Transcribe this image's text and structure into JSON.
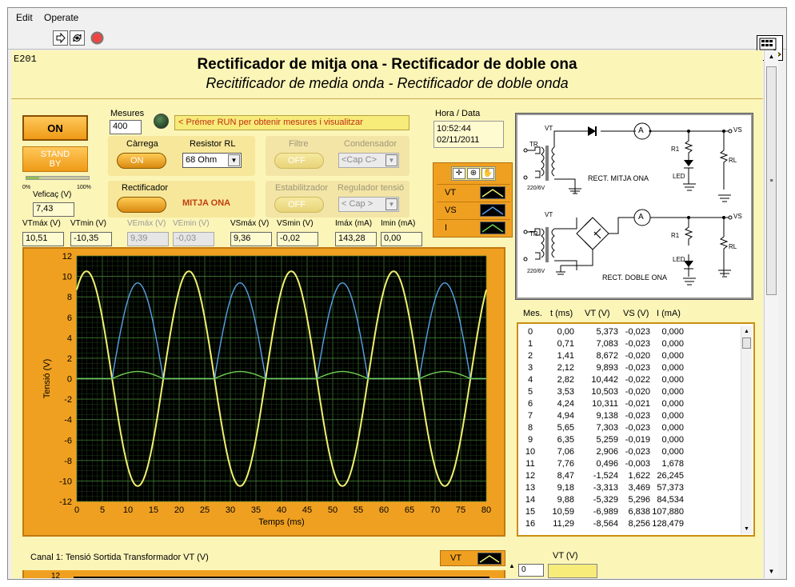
{
  "menu": {
    "edit": "Edit",
    "operate": "Operate"
  },
  "vi_icon": {
    "number": "1"
  },
  "panel": {
    "id": "E201",
    "title_cat": "Rectificador de mitja ona - Rectificador de doble ona",
    "title_es": "Recitificador de media onda - Rectificador de doble onda",
    "on_button": "ON",
    "standby_button": "STAND BY",
    "slider": {
      "min": "0%",
      "max": "100%",
      "value": 0.2
    },
    "mesures": {
      "label": "Mesures",
      "value": "400"
    },
    "message": "< Prémer RUN per obtenir mesures i visualitzar",
    "datetime": {
      "label": "Hora / Data",
      "time": "10:52:44",
      "date": "02/11/2011"
    },
    "carrega": {
      "label": "Càrrega",
      "state": "ON"
    },
    "resistor": {
      "label": "Resistor RL",
      "value": "68 Ohm"
    },
    "filtre": {
      "label": "Filtre",
      "state": "OFF"
    },
    "condensador": {
      "label": "Condensador",
      "value": "<Cap C>"
    },
    "rectificador": {
      "label": "Rectificador",
      "state_label": "MITJA ONA"
    },
    "estabilitzador": {
      "label": "Estabilitzador",
      "state": "OFF"
    },
    "regulador": {
      "label": "Regulador tensió",
      "value": "< Cap >"
    },
    "veficac": {
      "label": "Veficaç (V)",
      "value": "7,43"
    },
    "measurements": [
      {
        "label": "VTmáx (V)",
        "value": "10,51",
        "disabled": false
      },
      {
        "label": "VTmin (V)",
        "value": "-10,35",
        "disabled": false
      },
      {
        "label": "VEmáx (V)",
        "value": "9,39",
        "disabled": true
      },
      {
        "label": "VEmin (V)",
        "value": "-0,03",
        "disabled": true
      },
      {
        "label": "VSmáx (V)",
        "value": "9,36",
        "disabled": false
      },
      {
        "label": "VSmin (V)",
        "value": "-0,02",
        "disabled": false
      },
      {
        "label": "Imáx (mA)",
        "value": "143,28",
        "disabled": false
      },
      {
        "label": "Imin (mA)",
        "value": "0,00",
        "disabled": false
      }
    ],
    "legend": [
      {
        "name": "VT",
        "color": "#f0f070"
      },
      {
        "name": "VS",
        "color": "#5aa0e6"
      },
      {
        "name": "I",
        "color": "#70d050"
      }
    ],
    "circuit": {
      "label_half": "RECT. MITJA ONA",
      "label_full": "RECT. DOBLE ONA",
      "vt": "VT",
      "vs": "VS",
      "tr": "TR",
      "r1": "R1",
      "rl": "RL",
      "led": "LED",
      "a": "A",
      "mains": "220/6V"
    },
    "table": {
      "headers": [
        "Mes.",
        "t (ms)",
        "VT (V)",
        "VS (V)",
        "I (mA)"
      ],
      "rows": [
        [
          "0",
          "0,00",
          "5,373",
          "-0,023",
          "0,000"
        ],
        [
          "1",
          "0,71",
          "7,083",
          "-0,023",
          "0,000"
        ],
        [
          "2",
          "1,41",
          "8,672",
          "-0,020",
          "0,000"
        ],
        [
          "3",
          "2,12",
          "9,893",
          "-0,023",
          "0,000"
        ],
        [
          "4",
          "2,82",
          "10,442",
          "-0,022",
          "0,000"
        ],
        [
          "5",
          "3,53",
          "10,503",
          "-0,020",
          "0,000"
        ],
        [
          "6",
          "4,24",
          "10,311",
          "-0,021",
          "0,000"
        ],
        [
          "7",
          "4,94",
          "9,138",
          "-0,023",
          "0,000"
        ],
        [
          "8",
          "5,65",
          "7,303",
          "-0,023",
          "0,000"
        ],
        [
          "9",
          "6,35",
          "5,259",
          "-0,019",
          "0,000"
        ],
        [
          "10",
          "7,06",
          "2,906",
          "-0,023",
          "0,000"
        ],
        [
          "11",
          "7,76",
          "0,496",
          "-0,003",
          "1,678"
        ],
        [
          "12",
          "8,47",
          "-1,524",
          "1,622",
          "26,245"
        ],
        [
          "13",
          "9,18",
          "-3,313",
          "3,469",
          "57,373"
        ],
        [
          "14",
          "9,88",
          "-5,329",
          "5,296",
          "84,534"
        ],
        [
          "15",
          "10,59",
          "-6,989",
          "6,838",
          "107,880"
        ],
        [
          "16",
          "11,29",
          "-8,564",
          "8,256",
          "128,479"
        ]
      ]
    },
    "channel1": {
      "label": "Canal 1:  Tensió Sortida Transformador VT (V)",
      "legend": "VT",
      "y_top": "12"
    },
    "vt_indicator": {
      "label": "VT (V)",
      "value": "0"
    }
  },
  "chart_data": {
    "type": "line",
    "xlabel": "Temps (ms)",
    "ylabel": "Tensió (V)",
    "xlim": [
      0,
      80
    ],
    "ylim": [
      -12,
      12
    ],
    "xticks": [
      0,
      5,
      10,
      15,
      20,
      25,
      30,
      35,
      40,
      45,
      50,
      55,
      60,
      65,
      70,
      75,
      80
    ],
    "yticks": [
      -12,
      -10,
      -8,
      -6,
      -4,
      -2,
      0,
      2,
      4,
      6,
      8,
      10,
      12
    ],
    "grid": true,
    "period_ms": 20,
    "series": [
      {
        "name": "VT",
        "color": "#f0f070",
        "amplitude": 10.5,
        "phase_ms": -3.1
      },
      {
        "name": "VS",
        "color": "#5aa0e6",
        "amplitude": 9.36,
        "phase_ms": -3.1,
        "onset": 0.7
      },
      {
        "name": "I",
        "color": "#70d050",
        "amplitude": 0.7,
        "phase_ms": -3.1,
        "onset": 0.7
      }
    ]
  },
  "colors": {
    "panel": "#fbf5b8",
    "accent": "#f0a020",
    "plot_bg": "#000000",
    "grid": "#3a6a2a"
  }
}
